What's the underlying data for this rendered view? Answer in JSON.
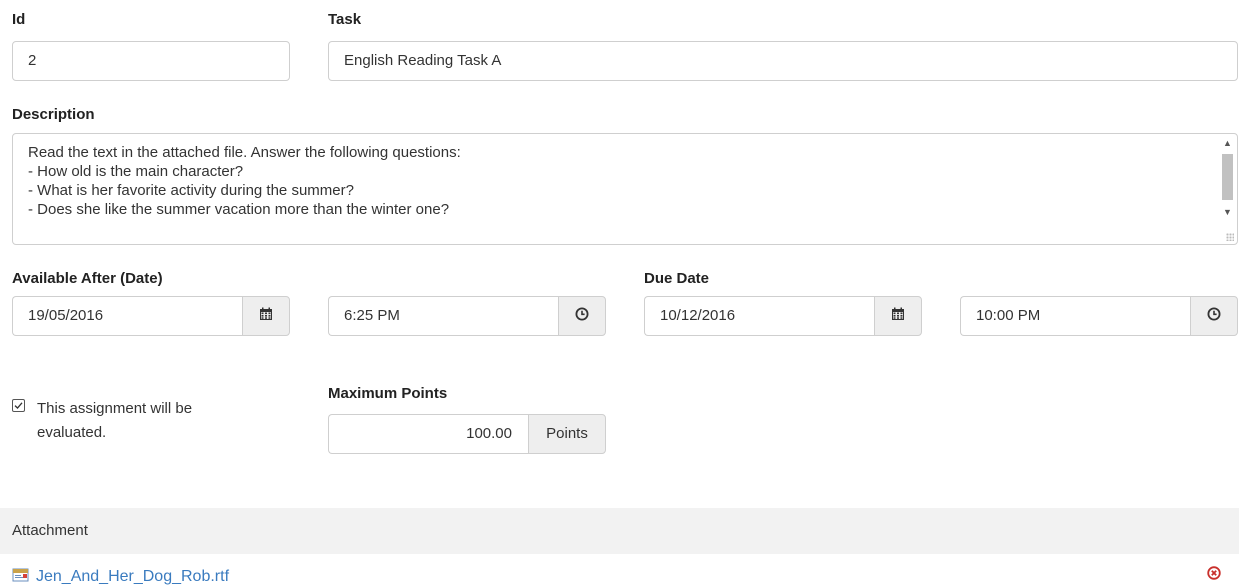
{
  "fields": {
    "id": {
      "label": "Id",
      "value": "2"
    },
    "task": {
      "label": "Task",
      "value": "English Reading Task A"
    },
    "description": {
      "label": "Description",
      "lines": [
        "Read the text in the attached file. Answer the following questions:",
        "- How old is the main character?",
        "- What is her favorite activity during the summer?",
        "- Does she like the summer vacation more than the winter one?"
      ]
    },
    "available_after": {
      "label": "Available After (Date)",
      "date": "19/05/2016",
      "time": "6:25 PM"
    },
    "due_date": {
      "label": "Due Date",
      "date": "10/12/2016",
      "time": "10:00 PM"
    },
    "evaluated": {
      "label": "This assignment will be evaluated.",
      "checked": true
    },
    "max_points": {
      "label": "Maximum Points",
      "value": "100.00",
      "unit": "Points"
    }
  },
  "attachment": {
    "header": "Attachment",
    "file_name": "Jen_And_Her_Dog_Rob.rtf"
  },
  "icons": {
    "calendar": "calendar-icon",
    "clock": "clock-icon",
    "file": "rtf-file-icon",
    "remove": "remove-circle-icon"
  },
  "colors": {
    "link": "#3a7bbf",
    "remove": "#c9302c",
    "addon_bg": "#eeeeee",
    "panel_bg": "#f2f2f2"
  }
}
